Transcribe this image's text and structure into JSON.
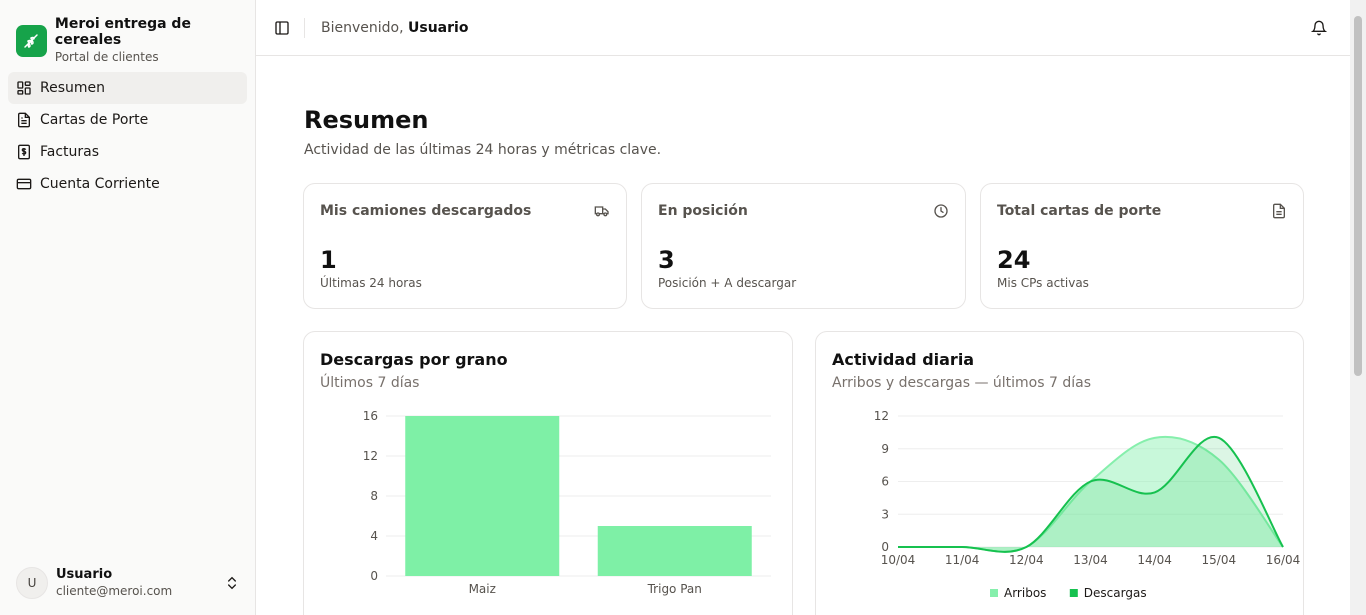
{
  "brand": {
    "title": "Meroi entrega de cereales",
    "subtitle": "Portal de clientes",
    "logo_icon": "wheat-icon"
  },
  "nav": [
    {
      "label": "Resumen",
      "icon": "dashboard-icon",
      "active": true
    },
    {
      "label": "Cartas de Porte",
      "icon": "document-icon"
    },
    {
      "label": "Facturas",
      "icon": "dollar-receipt-icon"
    },
    {
      "label": "Cuenta Corriente",
      "icon": "credit-card-icon"
    }
  ],
  "user": {
    "initial": "U",
    "name": "Usuario",
    "email": "cliente@meroi.com"
  },
  "header": {
    "welcome_prefix": "Bienvenido,",
    "welcome_name": "Usuario"
  },
  "page": {
    "title": "Resumen",
    "subtitle": "Actividad de las últimas 24 horas y métricas clave."
  },
  "stats": [
    {
      "label": "Mis camiones descargados",
      "value": "1",
      "desc": "Últimas 24 horas",
      "icon": "truck-icon"
    },
    {
      "label": "En posición",
      "value": "3",
      "desc": "Posición + A descargar",
      "icon": "clock-icon"
    },
    {
      "label": "Total cartas de porte",
      "value": "24",
      "desc": "Mis CPs activas",
      "icon": "file-icon"
    }
  ],
  "colors": {
    "accent": "#16a34a",
    "bar": "#7ef0a6",
    "area_light": "#86efac",
    "line_dark": "#16c14f"
  },
  "chart_data": [
    {
      "type": "bar",
      "title": "Descargas por grano",
      "subtitle": "Últimos 7 días",
      "categories": [
        "Maiz",
        "Trigo Pan"
      ],
      "values": [
        16,
        5
      ],
      "yticks": [
        0,
        4,
        8,
        12,
        16
      ],
      "ylim": [
        0,
        16
      ],
      "grid": true
    },
    {
      "type": "area",
      "title": "Actividad diaria",
      "subtitle": "Arribos y descargas — últimos 7 días",
      "x": [
        "10/04",
        "11/04",
        "12/04",
        "13/04",
        "14/04",
        "15/04",
        "16/04"
      ],
      "yticks": [
        0,
        3,
        6,
        9,
        12
      ],
      "ylim": [
        0,
        12
      ],
      "series": [
        {
          "name": "Arribos",
          "values": [
            0,
            0,
            0,
            6,
            10,
            8,
            0
          ]
        },
        {
          "name": "Descargas",
          "values": [
            0,
            0,
            0,
            6,
            5,
            10,
            0
          ]
        }
      ],
      "legend": "bottom",
      "grid": true
    }
  ]
}
